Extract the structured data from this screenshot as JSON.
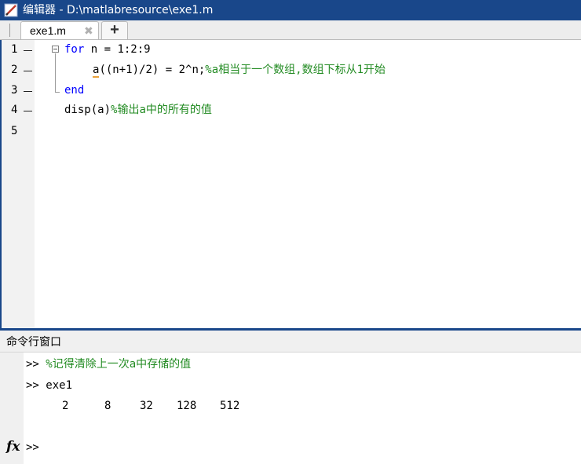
{
  "window": {
    "title": "编辑器 - D:\\matlabresource\\exe1.m"
  },
  "tabs": [
    {
      "label": "exe1.m",
      "close": "✖"
    }
  ],
  "add_tab_label": "+",
  "editor": {
    "line_numbers": [
      "1",
      "2",
      "3",
      "4",
      "5"
    ],
    "lines": {
      "l1": {
        "kw": "for",
        "rest": " n = 1:2:9"
      },
      "l2": {
        "var": "a",
        "code": "((n+1)/2) = 2^n;",
        "comment": "%a相当于一个数组,数组下标从1开始"
      },
      "l3": {
        "kw": "end"
      },
      "l4": {
        "code": "disp(a)",
        "comment": "%输出a中的所有的值"
      }
    }
  },
  "command_window": {
    "header": "命令行窗口",
    "prompt": ">>",
    "history": [
      {
        "prompt": ">>",
        "comment": "%记得清除上一次a中存储的值"
      },
      {
        "prompt": ">>",
        "code": "exe1"
      }
    ],
    "output_values": [
      "2",
      "8",
      "32",
      "128",
      "512"
    ],
    "fx_label": "fx"
  },
  "colors": {
    "title_bar": "#19478a",
    "keyword": "#0000ff",
    "comment": "#228b22",
    "variable_highlight": "#e9a23b"
  }
}
